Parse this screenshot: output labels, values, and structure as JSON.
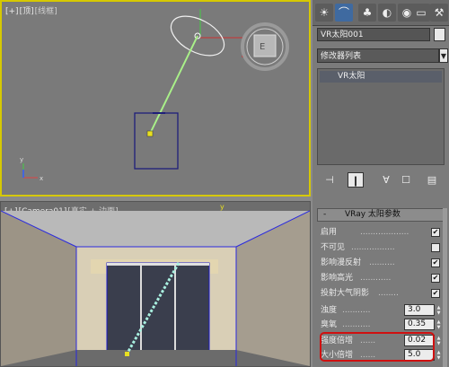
{
  "viewport_top": {
    "label": {
      "plus": "[+]",
      "view": "[顶]",
      "shading": "[线框]"
    }
  },
  "viewport_camera": {
    "label": {
      "plus": "[+]",
      "view": "[Camera01]",
      "shading": "[真实 + 边面]"
    }
  },
  "panel": {
    "tabs": [
      {
        "icon": "sun-create-icon",
        "glyph": "☀"
      },
      {
        "icon": "modify-icon",
        "glyph": "⌒"
      },
      {
        "icon": "hierarchy-icon",
        "glyph": "♣"
      },
      {
        "icon": "motion-icon",
        "glyph": "◐"
      },
      {
        "icon": "display-icon",
        "glyph": "◉"
      },
      {
        "icon": "utilities-icon",
        "glyph": "▭"
      },
      {
        "icon": "wrench-icon",
        "glyph": "⚒"
      }
    ],
    "object_name": "VR太阳001",
    "object_color": "#e8e8e8",
    "modifier_list": "修改器列表",
    "stack_item": "VR太阳",
    "rollout_title": "VRay 太阳参数",
    "rollout_minus": "-",
    "params": [
      {
        "label": "启用",
        "dots": "...................",
        "type": "check",
        "checked": "✔"
      },
      {
        "label": "不可见",
        "dots": ".................",
        "type": "check",
        "checked": ""
      },
      {
        "label": "影响漫反射",
        "dots": "..........",
        "type": "check",
        "checked": "✔"
      },
      {
        "label": "影响高光",
        "dots": "............",
        "type": "check",
        "checked": "✔"
      },
      {
        "label": "投射大气阴影",
        "dots": "........",
        "type": "check",
        "checked": "✔"
      },
      {
        "label": "浊度",
        "dots": "...........",
        "type": "spin",
        "value": "3.0"
      },
      {
        "label": "臭氧",
        "dots": "...........",
        "type": "spin",
        "value": "0.35"
      },
      {
        "label": "强度倍增",
        "dots": "......",
        "type": "spin",
        "value": "0.02"
      },
      {
        "label": "大小倍增",
        "dots": "......",
        "type": "spin",
        "value": "5.0"
      }
    ],
    "highlight_color": "#d01010"
  }
}
